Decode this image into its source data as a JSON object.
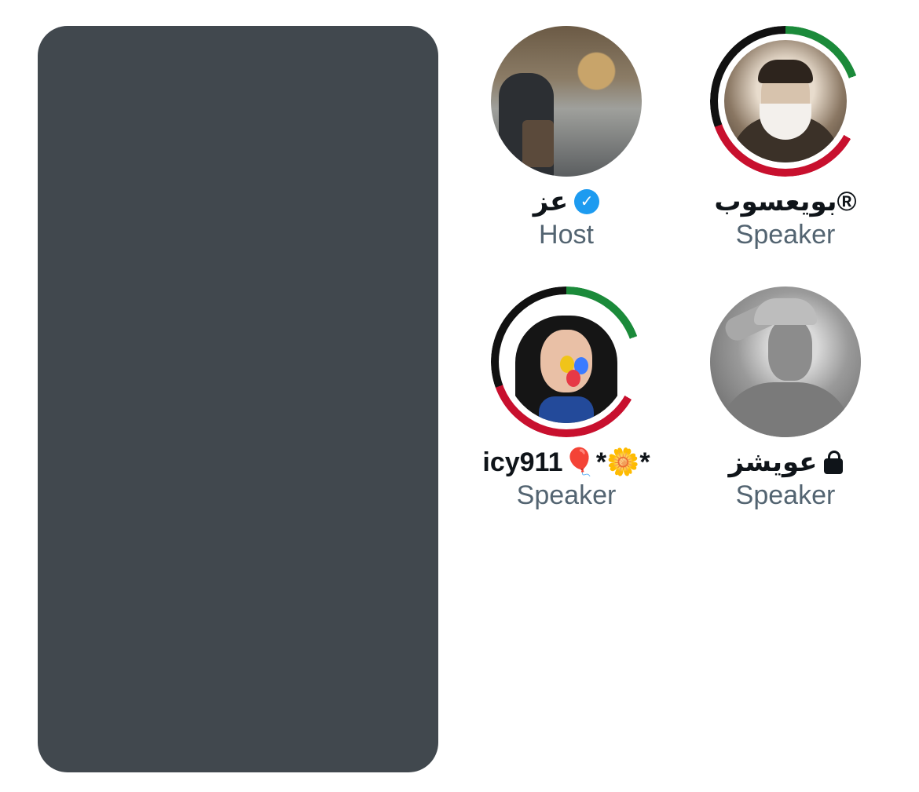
{
  "participants": [
    {
      "name": "عز",
      "role": "Host",
      "verified": true,
      "avatar": "outdoor-photo-avatar"
    },
    {
      "name": "بويعسوب®",
      "role": "Speaker",
      "verified": false,
      "avatar": "bearded-man-illustration-avatar"
    },
    {
      "name": "icy911🎈*🌼*",
      "role": "Speaker",
      "verified": false,
      "avatar": "cartoon-girl-avatar"
    },
    {
      "name": "عويشز",
      "role": "Speaker",
      "verified": false,
      "locked": true,
      "avatar": "saluting-soldier-avatar"
    }
  ],
  "colors": {
    "card": "#41484e",
    "name": "#0f1419",
    "role": "#536471",
    "verified": "#1d9bf0"
  }
}
